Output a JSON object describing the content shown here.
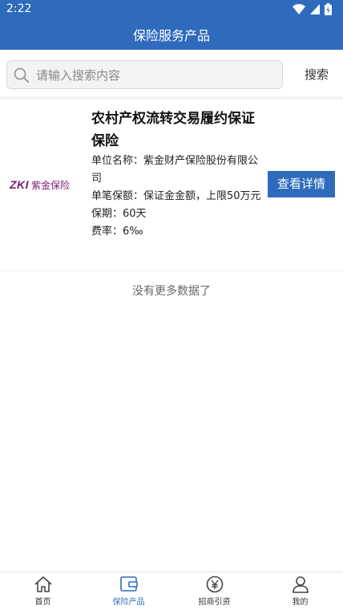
{
  "status_bar": {
    "time": "2:22"
  },
  "header": {
    "title": "保险服务产品"
  },
  "search": {
    "placeholder": "请输入搜索内容",
    "button_label": "搜索"
  },
  "product": {
    "logo_text_en": "ZKI",
    "logo_text_cn": "紫金保险",
    "title": "农村产权流转交易履约保证保险",
    "company": "单位名称：紫金财产保险股份有限公司",
    "premium": "单笔保额：保证金金额，上限50万元",
    "period": "保期：60天",
    "rate": "费率：6‰",
    "detail_button": "查看详情"
  },
  "list_footer": "没有更多数据了",
  "tabbar": {
    "items": [
      {
        "label": "首页",
        "icon": "home-icon"
      },
      {
        "label": "保险产品",
        "icon": "insurance-card-icon",
        "active": true
      },
      {
        "label": "招商引资",
        "icon": "yen-coin-icon"
      },
      {
        "label": "我的",
        "icon": "user-icon"
      }
    ]
  },
  "colors": {
    "primary": "#2f6bbd",
    "logo": "#7a1e6e"
  }
}
